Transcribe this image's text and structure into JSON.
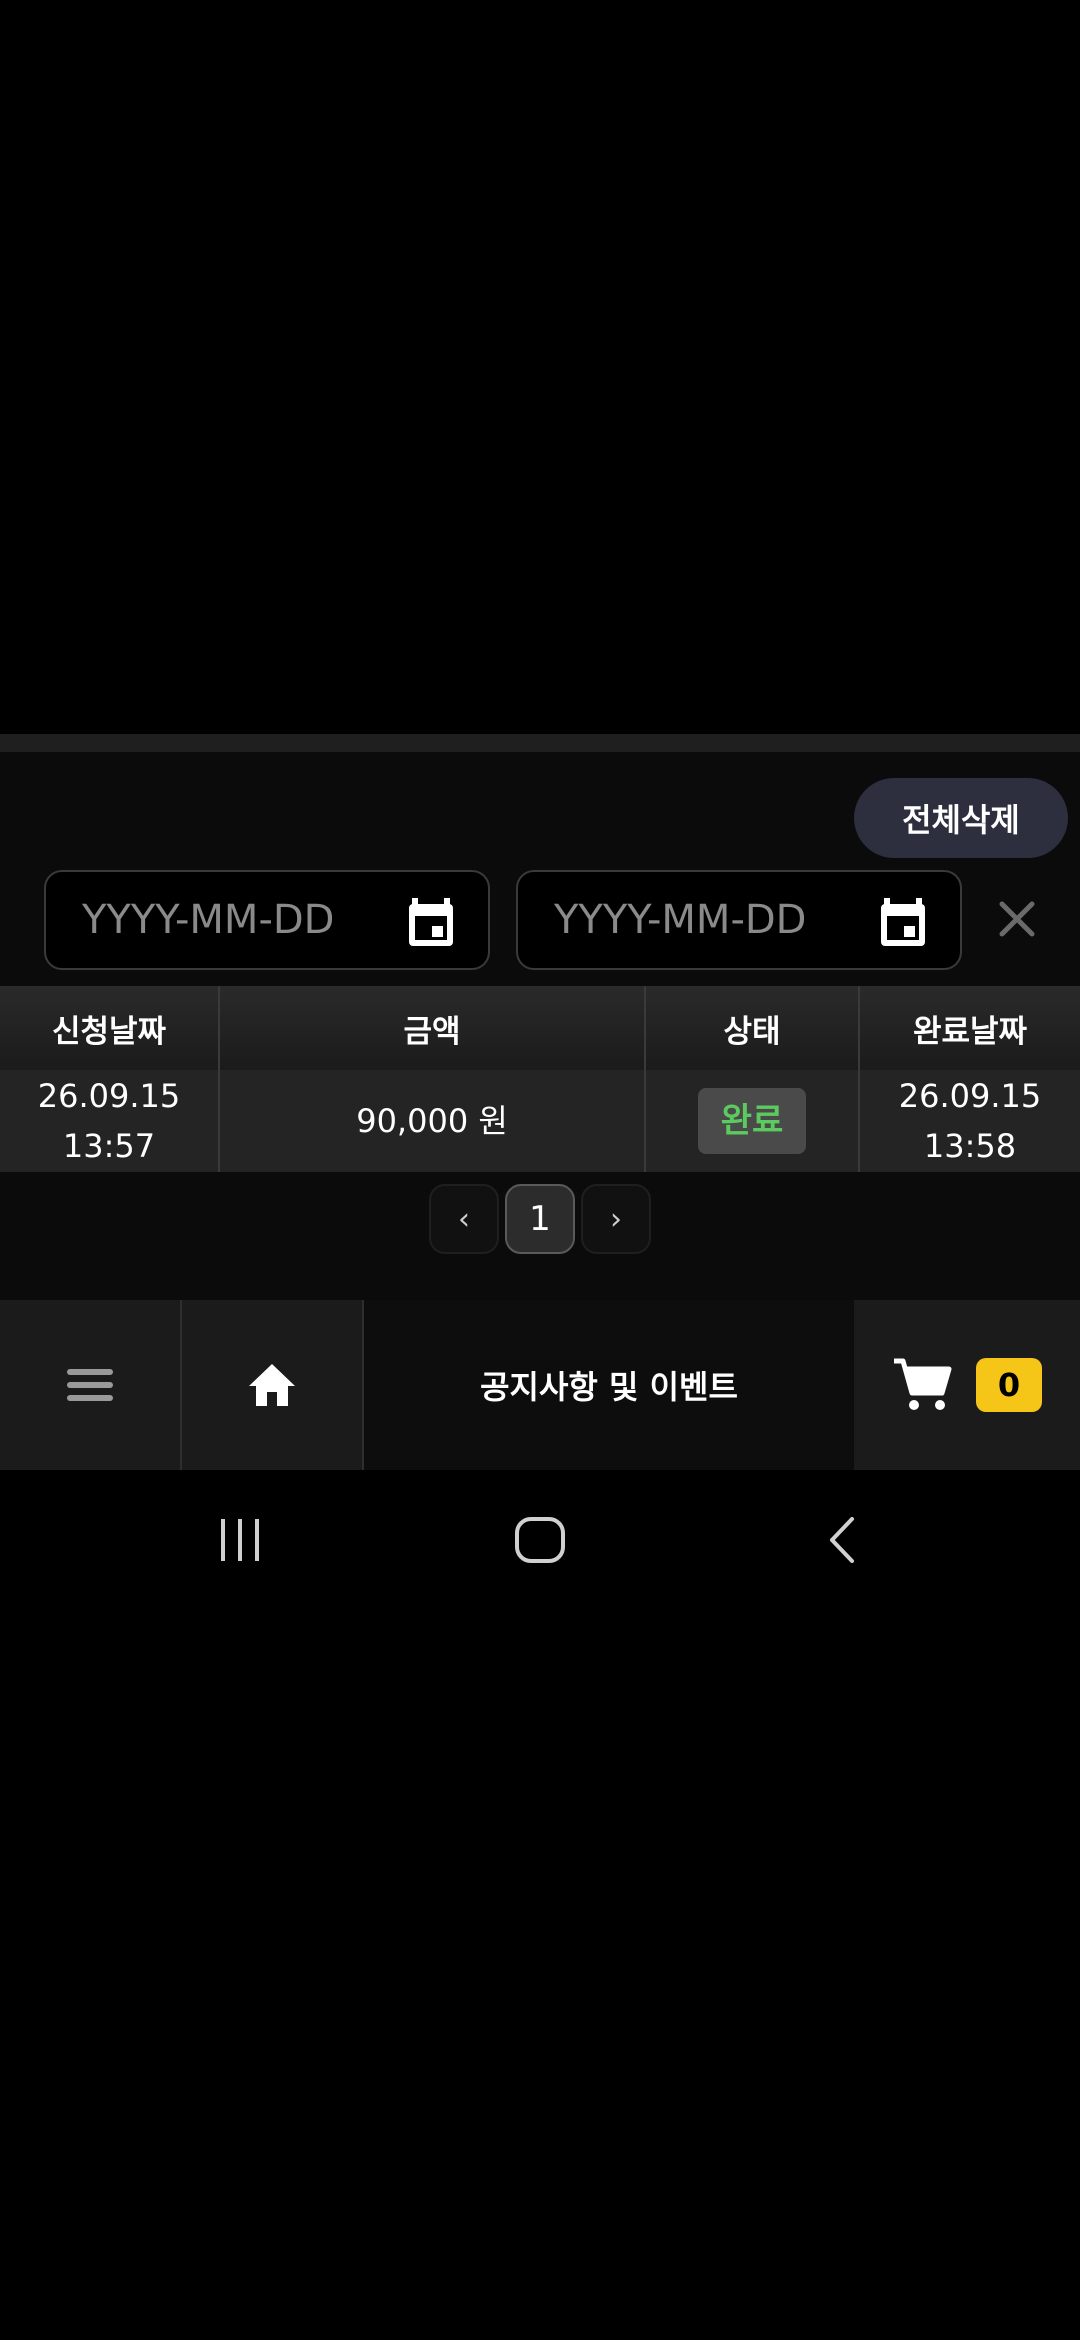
{
  "toolbar": {
    "delete_all_label": "전체삭제"
  },
  "filters": {
    "start_date": {
      "value": "",
      "placeholder": "YYYY-MM-DD"
    },
    "end_date": {
      "value": "",
      "placeholder": "YYYY-MM-DD"
    }
  },
  "table": {
    "headers": [
      "신청날짜",
      "금액",
      "상태",
      "완료날짜"
    ],
    "rows": [
      {
        "request_date": "26.09.15",
        "request_time": "13:57",
        "amount": "90,000 원",
        "status": "완료",
        "complete_date": "26.09.15",
        "complete_time": "13:58"
      }
    ]
  },
  "pagination": {
    "prev": "‹",
    "current": "1",
    "next": "›"
  },
  "bottom_bar": {
    "notice_label": "공지사항 및 이벤트",
    "cart_count": "0"
  },
  "icons": {
    "calendar": "calendar-icon",
    "close": "close-icon",
    "menu": "hamburger-menu-icon",
    "home": "home-icon",
    "cart": "cart-icon",
    "recents": "recent-apps-icon",
    "system_home": "system-home-icon",
    "back": "back-icon"
  },
  "colors": {
    "status_done": "#5ccb5f",
    "cart_badge": "#f5c518",
    "delete_button_bg": "#2d2f3f"
  }
}
